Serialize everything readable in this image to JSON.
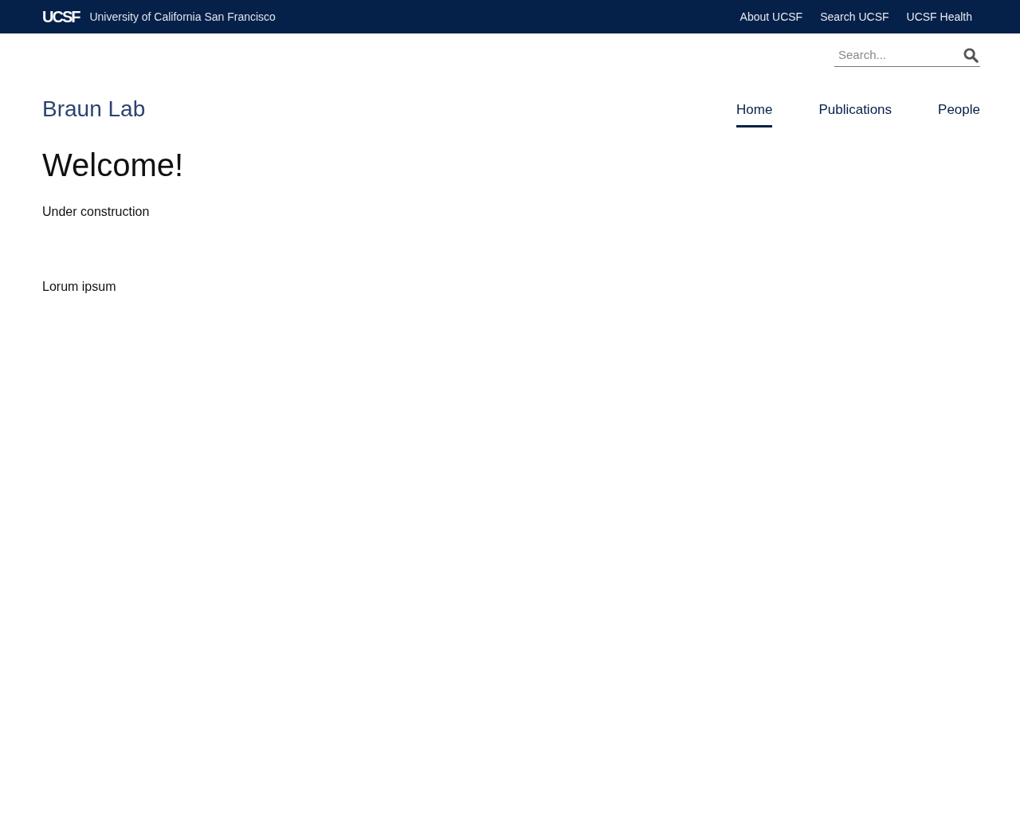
{
  "top_bar": {
    "logo": "UCSF",
    "university": "University of California San Francisco",
    "links": [
      "About UCSF",
      "Search UCSF",
      "UCSF Health"
    ]
  },
  "search": {
    "placeholder": "Search..."
  },
  "site_title": "Braun Lab",
  "nav": [
    {
      "label": "Home",
      "selected": true
    },
    {
      "label": "Publications",
      "selected": false
    },
    {
      "label": "People",
      "selected": false
    }
  ],
  "heading": "Welcome!",
  "paragraphs": [
    "Under construction",
    "Lorum ipsum"
  ]
}
